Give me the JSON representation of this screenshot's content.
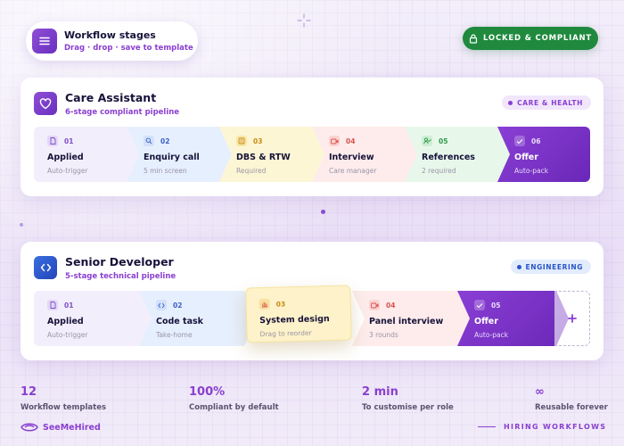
{
  "header": {
    "title": "Workflow stages",
    "subtitle": "Drag · drop · save to template",
    "menu_icon": "menu-icon"
  },
  "status_badge": {
    "label": "LOCKED & COMPLIANT",
    "icon": "lock-icon",
    "color": "#1f8a3e"
  },
  "workflows": [
    {
      "title": "Care Assistant",
      "subtitle": "6-stage compliant pipeline",
      "icon": "heart-icon",
      "tag": "CARE & HEALTH",
      "stages": [
        {
          "num": "01",
          "name": "Applied",
          "desc": "Auto-trigger",
          "icon": "document-icon",
          "bg": "#f3eefb",
          "accent": "#7b4fc8"
        },
        {
          "num": "02",
          "name": "Enquiry call",
          "desc": "5 min screen",
          "icon": "search-icon",
          "bg": "#e6effd",
          "accent": "#3c5fc8"
        },
        {
          "num": "03",
          "name": "DBS & RTW",
          "desc": "Required",
          "icon": "id-card-icon",
          "bg": "#fdf6d4",
          "accent": "#c98a12"
        },
        {
          "num": "04",
          "name": "Interview",
          "desc": "Care manager",
          "icon": "video-icon",
          "bg": "#fdeceb",
          "accent": "#d9534f"
        },
        {
          "num": "05",
          "name": "References",
          "desc": "2 required",
          "icon": "user-check-icon",
          "bg": "#e7f8ea",
          "accent": "#2f9a4a"
        },
        {
          "num": "06",
          "name": "Offer",
          "desc": "Auto-pack",
          "icon": "check-icon",
          "bg": "#7a2fc4",
          "accent": "#ffffff"
        }
      ]
    },
    {
      "title": "Senior Developer",
      "subtitle": "5-stage technical pipeline",
      "icon": "code-icon",
      "tag": "ENGINEERING",
      "stages": [
        {
          "num": "01",
          "name": "Applied",
          "desc": "Auto-trigger",
          "icon": "document-icon",
          "bg": "#f3eefb",
          "accent": "#7b4fc8"
        },
        {
          "num": "02",
          "name": "Code task",
          "desc": "Take-home",
          "icon": "code-icon",
          "bg": "#e6effd",
          "accent": "#3c5fc8"
        },
        {
          "num": "03",
          "name": "System design",
          "desc": "Drag to reorder",
          "icon": "hand-icon",
          "bg": "#fdf2c9",
          "accent": "#c98a12"
        },
        {
          "num": "04",
          "name": "Panel interview",
          "desc": "3 rounds",
          "icon": "video-icon",
          "bg": "#fdeceb",
          "accent": "#d9534f"
        },
        {
          "num": "05",
          "name": "Offer",
          "desc": "Auto-pack",
          "icon": "check-icon",
          "bg": "#7a2fc4",
          "accent": "#ffffff"
        }
      ],
      "add_stage_icon": "plus-icon"
    }
  ],
  "stats": [
    {
      "value": "12",
      "label": "Workflow templates"
    },
    {
      "value": "100%",
      "label": "Compliant by default"
    },
    {
      "value": "2 min",
      "label": "To customise per role"
    },
    {
      "value": "∞",
      "label": "Reusable forever"
    }
  ],
  "footer": {
    "brand": "SeeMeHired",
    "tagline": "HIRING WORKFLOWS"
  }
}
